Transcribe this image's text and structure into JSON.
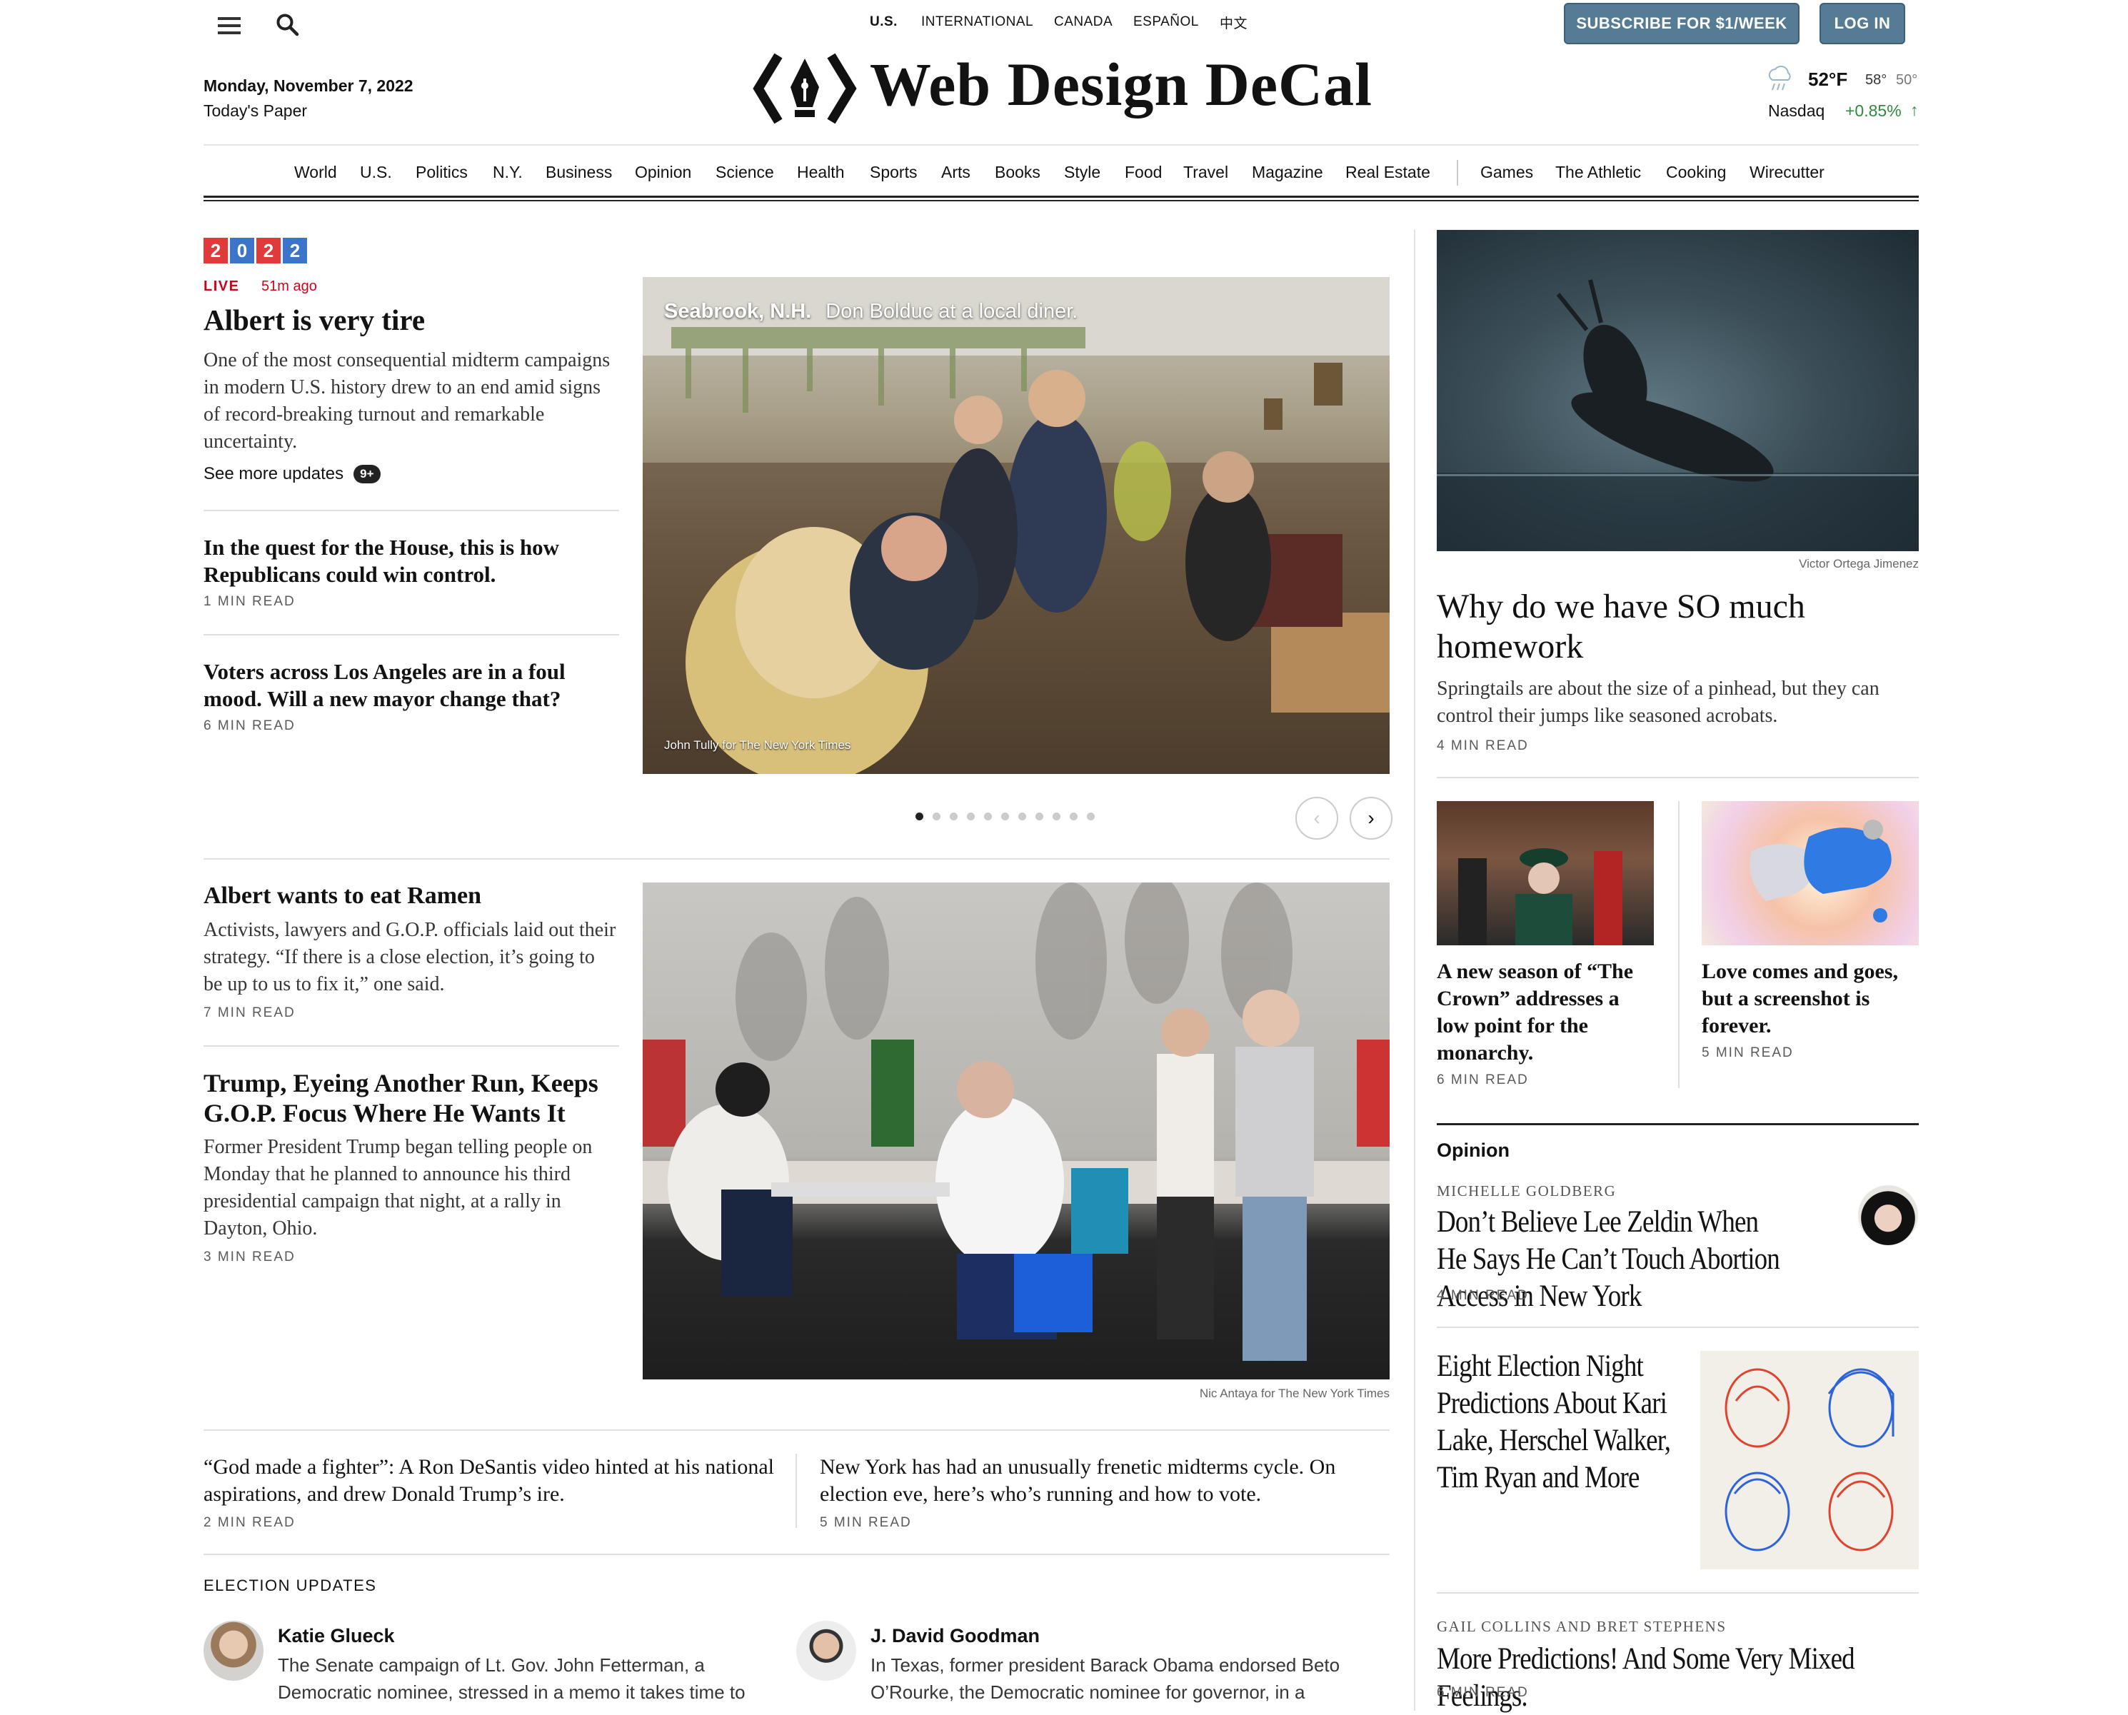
{
  "header": {
    "editions": [
      "U.S.",
      "INTERNATIONAL",
      "CANADA",
      "ESPAÑOL",
      "中文"
    ],
    "subscribe_label": "SUBSCRIBE FOR $1/WEEK",
    "login_label": "LOG IN",
    "date": "Monday, November 7, 2022",
    "todays_paper": "Today's Paper",
    "masthead": "Web Design DeCal",
    "weather": {
      "temp": "52°F",
      "high": "58°",
      "low": "50°"
    },
    "market": {
      "name": "Nasdaq",
      "change": "+0.85%",
      "arrow": "↑"
    }
  },
  "nav": {
    "items": [
      "World",
      "U.S.",
      "Politics",
      "N.Y.",
      "Business",
      "Opinion",
      "Science",
      "Health",
      "Sports",
      "Arts",
      "Books",
      "Style",
      "Food",
      "Travel",
      "Magazine",
      "Real Estate"
    ],
    "extra": [
      "Games",
      "The Athletic",
      "Cooking",
      "Wirecutter"
    ]
  },
  "badge": {
    "digits": [
      "2",
      "0",
      "2",
      "2"
    ],
    "colors": [
      "#e03a3a",
      "#3b74c9",
      "#e03a3a",
      "#3b74c9"
    ]
  },
  "lead": {
    "live": "LIVE",
    "time": "51m ago",
    "headline": "Albert is very tire",
    "summary": "One of the most consequential midterm campaigns in modern U.S. history drew to an end amid signs of record-breaking turnout and remarkable uncertainty.",
    "see_more": "See more updates",
    "count": "9+"
  },
  "left_stories": [
    {
      "headline": "In the quest for the House, this is how Republicans could win control.",
      "read": "1 MIN READ"
    },
    {
      "headline": "Voters across Los Angeles are in a foul mood. Will a new mayor change that?",
      "read": "6 MIN READ"
    }
  ],
  "slideshow": {
    "place": "Seabrook, N.H.",
    "caption": "Don Bolduc at a local diner.",
    "credit": "John Tully for The New York Times",
    "dots_total": 11,
    "active_dot": 0
  },
  "second": {
    "headline": "Albert wants to eat Ramen",
    "summary": "Activists, lawyers and G.O.P. officials laid out their strategy. “If there is a close election, it’s going to be up to us to fix it,” one said.",
    "read": "7 MIN READ",
    "headline2": "Trump, Eyeing Another Run, Keeps G.O.P. Focus Where He Wants It",
    "summary2": "Former President Trump began telling people on Monday that he planned to announce his third presidential campaign that night, at a rally in Dayton, Ohio.",
    "read2": "3 MIN READ",
    "photo_credit": "Nic Antaya for The New York Times"
  },
  "bottom_row": [
    {
      "headline": "“God made a fighter”: A Ron DeSantis video hinted at his national aspirations, and drew Donald Trump’s ire.",
      "read": "2 MIN READ"
    },
    {
      "headline": "New York has had an unusually frenetic midterms cycle. On election eve, here’s who’s running and how to vote.",
      "read": "5 MIN READ"
    }
  ],
  "election_updates": {
    "label": "ELECTION UPDATES",
    "items": [
      {
        "author": "Katie Glueck",
        "text": "The Senate campaign of Lt. Gov. John Fetterman, a Democratic nominee, stressed in a memo it takes time to"
      },
      {
        "author": "J. David Goodman",
        "text": "In Texas, former president Barack Obama endorsed Beto O’Rourke, the Democratic nominee for governor, in a"
      }
    ]
  },
  "right": {
    "photo_credit": "Victor Ortega Jimenez",
    "headline": "Why do we have SO much homework",
    "summary": "Springtails are about the size of a pinhead, but they can control their jumps like seasoned acrobats.",
    "read": "4 MIN READ",
    "small": [
      {
        "headline": "A new season of “The Crown” addresses a low point for the monarchy.",
        "read": "6 MIN READ"
      },
      {
        "headline": "Love comes and goes, but a screenshot is forever.",
        "read": "5 MIN READ"
      }
    ],
    "opinion_label": "Opinion",
    "op1": {
      "author": "MICHELLE GOLDBERG",
      "headline": "Don’t Believe Lee Zeldin When He Says He Can’t Touch Abortion Access in New York",
      "read": "4 MIN READ"
    },
    "op2": {
      "headline": "Eight Election Night Predictions About Kari Lake, Herschel Walker, Tim Ryan and More"
    },
    "op3": {
      "author": "GAIL COLLINS AND BRET STEPHENS",
      "headline": "More Predictions! And Some Very Mixed Feelings.",
      "read": "6 MIN READ"
    }
  }
}
